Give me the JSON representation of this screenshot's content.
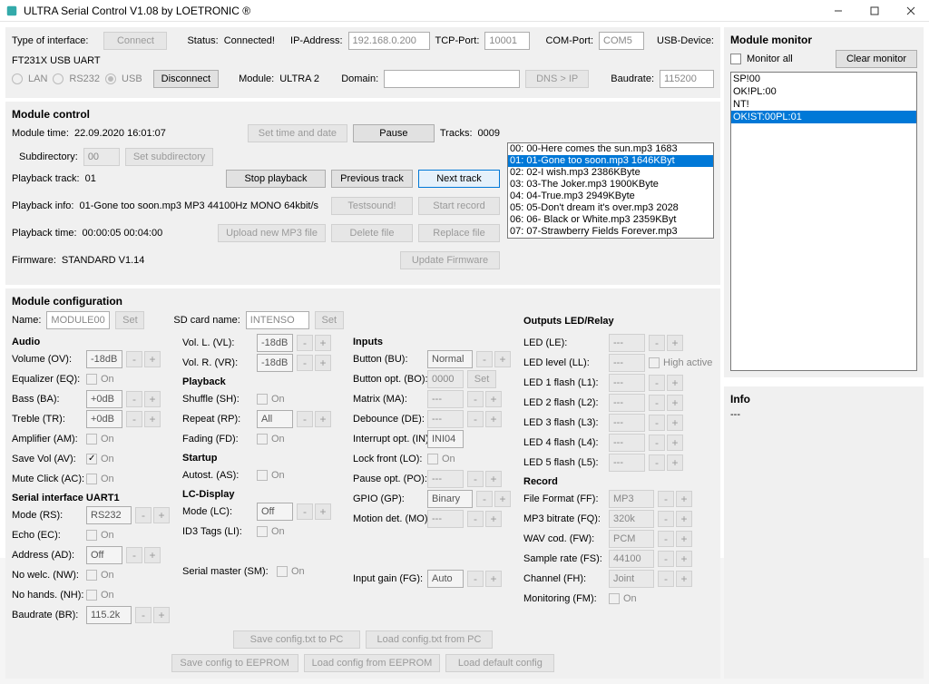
{
  "window": {
    "title": "ULTRA Serial Control V1.08 by LOETRONIC ®"
  },
  "top": {
    "type_label": "Type of interface:",
    "connect": "Connect",
    "disconnect": "Disconnect",
    "status_label": "Status:",
    "status_value": "Connected!",
    "module_label": "Module:",
    "module_value": "ULTRA 2",
    "ip_label": "IP-Address:",
    "ip_value": "192.168.0.200",
    "tcp_label": "TCP-Port:",
    "tcp_value": "10001",
    "domain_label": "Domain:",
    "domain_value": "",
    "dns_ip": "DNS > IP",
    "com_label": "COM-Port:",
    "com_value": "COM5",
    "usb_label": "USB-Device:",
    "usb_value": "FT231X USB UART",
    "baud_label": "Baudrate:",
    "baud_value": "115200",
    "radio_lan": "LAN",
    "radio_rs232": "RS232",
    "radio_usb": "USB"
  },
  "mc": {
    "title": "Module control",
    "module_time_label": "Module time:",
    "module_time_value": "22.09.2020 16:01:07",
    "set_time": "Set time and date",
    "pause": "Pause",
    "tracks_label": "Tracks:",
    "tracks_value": "0009",
    "subdir_label": "Subdirectory:",
    "subdir_value": "00",
    "set_subdir": "Set subdirectory",
    "playback_track_label": "Playback track:",
    "playback_track_value": "01",
    "stop_playback": "Stop playback",
    "prev_track": "Previous track",
    "next_track": "Next track",
    "playback_info_label": "Playback info:",
    "playback_info_value": "01-Gone too soon.mp3 MP3 44100Hz MONO 64kbit/s",
    "testsound": "Testsound!",
    "start_record": "Start record",
    "playback_time_label": "Playback time:",
    "playback_time_value": "00:00:05 00:04:00",
    "upload_mp3": "Upload new MP3 file",
    "delete_file": "Delete file",
    "replace_file": "Replace file",
    "firmware_label": "Firmware:",
    "firmware_value": "STANDARD V1.14",
    "update_fw": "Update Firmware",
    "tracks": [
      "00: 00-Here comes the sun.mp3 1683",
      "01: 01-Gone too soon.mp3 1646KByt",
      "02: 02-I wish.mp3 2386KByte",
      "03: 03-The Joker.mp3 1900KByte",
      "04: 04-True.mp3 2949KByte",
      "05: 05-Don't dream it's over.mp3 2028",
      "06: 06- Black or White.mp3 2359KByt",
      "07: 07-Strawberry Fields Forever.mp3"
    ],
    "track_selected": 1
  },
  "cfg": {
    "title": "Module configuration",
    "name_label": "Name:",
    "name_value": "MODULE00",
    "set": "Set",
    "sd_label": "SD card name:",
    "sd_value": "INTENSO",
    "audio_head": "Audio",
    "ov_label": "Volume (OV):",
    "ov_value": "-18dB",
    "eq_label": "Equalizer (EQ):",
    "on": "On",
    "ba_label": "Bass (BA):",
    "ba_value": "+0dB",
    "tr_label": "Treble (TR):",
    "tr_value": "+0dB",
    "am_label": "Amplifier (AM):",
    "av_label": "Save Vol (AV):",
    "ac_label": "Mute Click (AC):",
    "serial_head": "Serial interface UART1",
    "rs_label": "Mode (RS):",
    "rs_value": "RS232",
    "ec_label": "Echo (EC):",
    "ad_label": "Address (AD):",
    "ad_value": "Off",
    "nw_label": "No welc. (NW):",
    "nh_label": "No hands. (NH):",
    "sm_pre": "Serial master (SM):",
    "br_label": "Baudrate (BR):",
    "br_value": "115.2k",
    "vl_label": "Vol. L. (VL):",
    "vl_value": "-18dB",
    "vr_label": "Vol. R. (VR):",
    "vr_value": "-18dB",
    "playback_head": "Playback",
    "sh_label": "Shuffle (SH):",
    "rp_label": "Repeat (RP):",
    "rp_value": "All",
    "fd_label": "Fading (FD):",
    "startup_head": "Startup",
    "as_label": "Autost. (AS):",
    "lcd_head": "LC-Display",
    "lc_label": "Mode (LC):",
    "lc_value": "Off",
    "li_label": "ID3 Tags (LI):",
    "inputs_head": "Inputs",
    "bu_label": "Button (BU):",
    "bu_value": "Normal",
    "bo_label": "Button opt. (BO):",
    "bo_value": "0000",
    "ma_label": "Matrix (MA):",
    "ma_value": "---",
    "de_label": "Debounce (DE):",
    "de_value": "---",
    "in_label": "Interrupt opt. (IN):",
    "in_value": "INI04",
    "lo_label": "Lock front (LO):",
    "po_label": "Pause opt. (PO):",
    "po_value": "---",
    "gp_label": "GPIO (GP):",
    "gp_value": "Binary",
    "mo_label": "Motion det. (MO):",
    "mo_value": "---",
    "fg_label": "Input gain (FG):",
    "fg_value": "Auto",
    "outputs_head": "Outputs LED/Relay",
    "le_label": "LED (LE):",
    "le_value": "---",
    "ll_label": "LED level (LL):",
    "ll_value": "---",
    "ll_high": "High active",
    "l1_label": "LED 1 flash (L1):",
    "l1_value": "---",
    "l2_label": "LED 2 flash (L2):",
    "l2_value": "---",
    "l3_label": "LED 3 flash (L3):",
    "l3_value": "---",
    "l4_label": "LED 4 flash (L4):",
    "l4_value": "---",
    "l5_label": "LED 5 flash (L5):",
    "l5_value": "---",
    "record_head": "Record",
    "ff_label": "File Format (FF):",
    "ff_value": "MP3",
    "fq_label": "MP3 bitrate (FQ):",
    "fq_value": "320k",
    "fw_label": "WAV cod. (FW):",
    "fw_value": "PCM",
    "fs_label": "Sample rate (FS):",
    "fs_value": "44100",
    "fh_label": "Channel (FH):",
    "fh_value": "Joint",
    "fm_label": "Monitoring (FM):",
    "save_txt": "Save config.txt to PC",
    "load_txt": "Load config.txt from PC",
    "save_eeprom": "Save config to EEPROM",
    "load_eeprom": "Load config from EEPROM",
    "load_default": "Load default config"
  },
  "monitor": {
    "title": "Module monitor",
    "monitor_all": "Monitor all",
    "clear": "Clear monitor",
    "items": [
      "SP!00",
      "OK!PL:00",
      "NT!",
      "OK!ST:00PL:01"
    ],
    "selected": 3
  },
  "info": {
    "title": "Info",
    "text": "---"
  }
}
